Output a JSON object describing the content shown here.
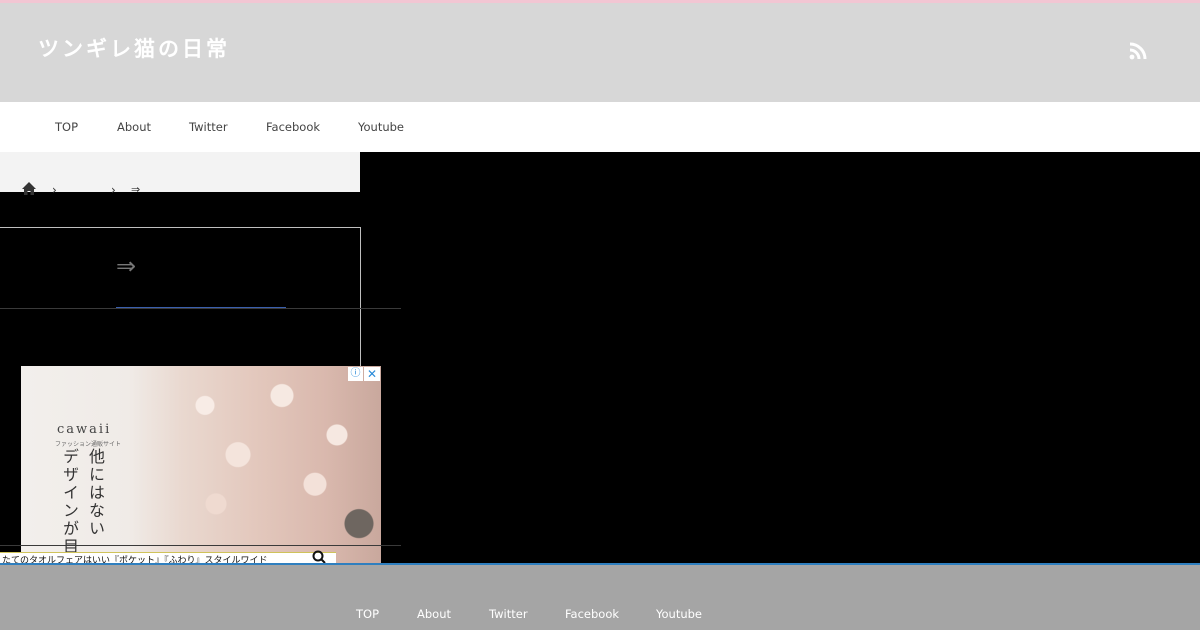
{
  "header": {
    "site_title": "ツンギレ猫の日常",
    "rss_icon": "rss-icon",
    "accent_line_color": "#f2c6d3",
    "background_color": "#d7d7d7"
  },
  "nav": {
    "items": [
      "TOP",
      "About",
      "Twitter",
      "Facebook",
      "Youtube"
    ]
  },
  "breadcrumb": {
    "home_icon": "home-icon",
    "separator": "›",
    "current": "⇒"
  },
  "article": {
    "title": "⇒",
    "underline_color": "#3a5fae"
  },
  "ad": {
    "brand": "cawaii",
    "subtitle": "ファッション通販サイト",
    "tagline_col1": "他にはない",
    "tagline_col2": "デザインが目",
    "info_icon": "ⓘ",
    "close_icon": "✕"
  },
  "bottom_ad": {
    "text": "たてのタオルフェアはいい『ポケット』『ふわり』スタイルワイド"
  },
  "footer": {
    "items": [
      "TOP",
      "About",
      "Twitter",
      "Facebook",
      "Youtube"
    ],
    "background_color": "#a5a5a5",
    "border_color": "#2f7fbf"
  }
}
